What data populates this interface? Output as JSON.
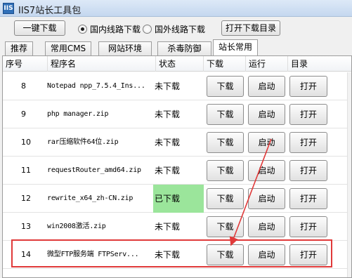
{
  "window": {
    "title": "IIS7站长工具包",
    "icon_text": "IIS"
  },
  "toolbar": {
    "one_click_download": "一键下载",
    "radio_domestic": "国内线路下载",
    "radio_foreign": "国外线路下载",
    "selected_radio": "国内线路下载",
    "open_download_dir": "打开下载目录"
  },
  "tabs": [
    {
      "label": "推荐"
    },
    {
      "label": "常用CMS"
    },
    {
      "label": "网站环境"
    },
    {
      "label": "杀毒防御"
    },
    {
      "label": "站长常用",
      "active": true
    }
  ],
  "list": {
    "headers": {
      "index": "序号",
      "name": "程序名",
      "status": "状态",
      "download": "下载",
      "run": "运行",
      "dir": "目录"
    },
    "rows": [
      {
        "index": "8",
        "name": "Notepad npp_7.5.4_Ins...",
        "status": "未下载",
        "downloaded": false,
        "dl": "下载",
        "run": "启动",
        "open": "打开"
      },
      {
        "index": "9",
        "name": "php manager.zip",
        "status": "未下载",
        "downloaded": false,
        "dl": "下载",
        "run": "启动",
        "open": "打开"
      },
      {
        "index": "10",
        "name": "rar压缩软件64位.zip",
        "status": "未下载",
        "downloaded": false,
        "dl": "下载",
        "run": "启动",
        "open": "打开"
      },
      {
        "index": "11",
        "name": "requestRouter_amd64.zip",
        "status": "未下载",
        "downloaded": false,
        "dl": "下载",
        "run": "启动",
        "open": "打开"
      },
      {
        "index": "12",
        "name": "rewrite_x64_zh-CN.zip",
        "status": "已下载",
        "downloaded": true,
        "dl": "下载",
        "run": "启动",
        "open": "打开"
      },
      {
        "index": "13",
        "name": "win2008激活.zip",
        "status": "未下载",
        "downloaded": false,
        "dl": "下载",
        "run": "启动",
        "open": "打开"
      },
      {
        "index": "14",
        "name": "微型FTP服务端 FTPServ...",
        "status": "未下载",
        "downloaded": false,
        "dl": "下载",
        "run": "启动",
        "open": "打开"
      }
    ]
  },
  "annotation": {
    "highlight_color": "#e03a3a",
    "status_done_color": "#9be59b"
  }
}
